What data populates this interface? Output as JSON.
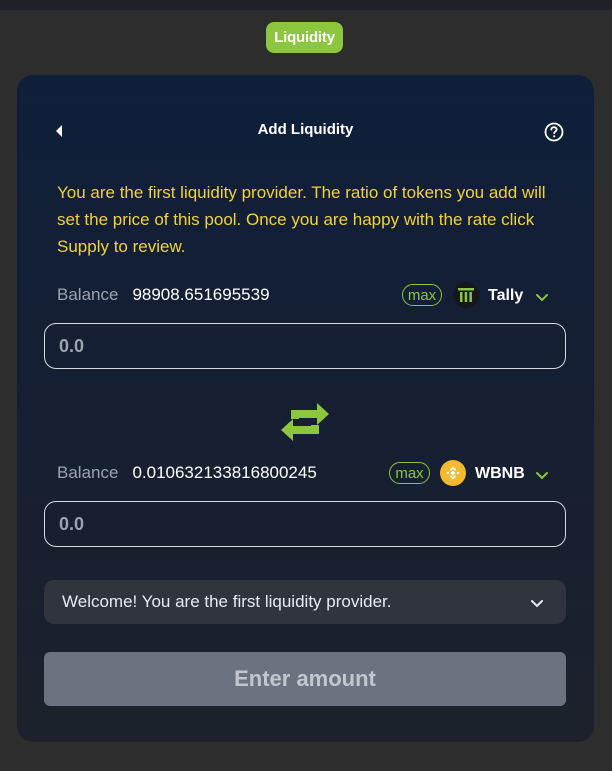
{
  "header": {
    "tab_label": "Liquidity"
  },
  "card": {
    "title": "Add Liquidity",
    "back_icon": "caret-left-icon",
    "help_icon": "question-circle-icon",
    "notice": "You are the first liquidity provider. The ratio of tokens you add will set the price of this pool. Once you are happy with the rate click Supply to review."
  },
  "token_a": {
    "balance_label": "Balance",
    "balance_value": "98908.651695539",
    "max_label": "max",
    "symbol": "Tally",
    "icon": "tally-token-icon",
    "amount_placeholder": "0.0"
  },
  "token_b": {
    "balance_label": "Balance",
    "balance_value": "0.010632133816800245",
    "max_label": "max",
    "symbol": "WBNB",
    "icon": "bnb-token-icon",
    "amount_placeholder": "0.0"
  },
  "swap_icon": "swap-arrows-icon",
  "info": {
    "text": "Welcome! You are the first liquidity provider."
  },
  "submit": {
    "label": "Enter amount"
  },
  "colors": {
    "accent": "#8cc63f",
    "notice": "#f2d23c",
    "bnb": "#f3ba2f"
  }
}
